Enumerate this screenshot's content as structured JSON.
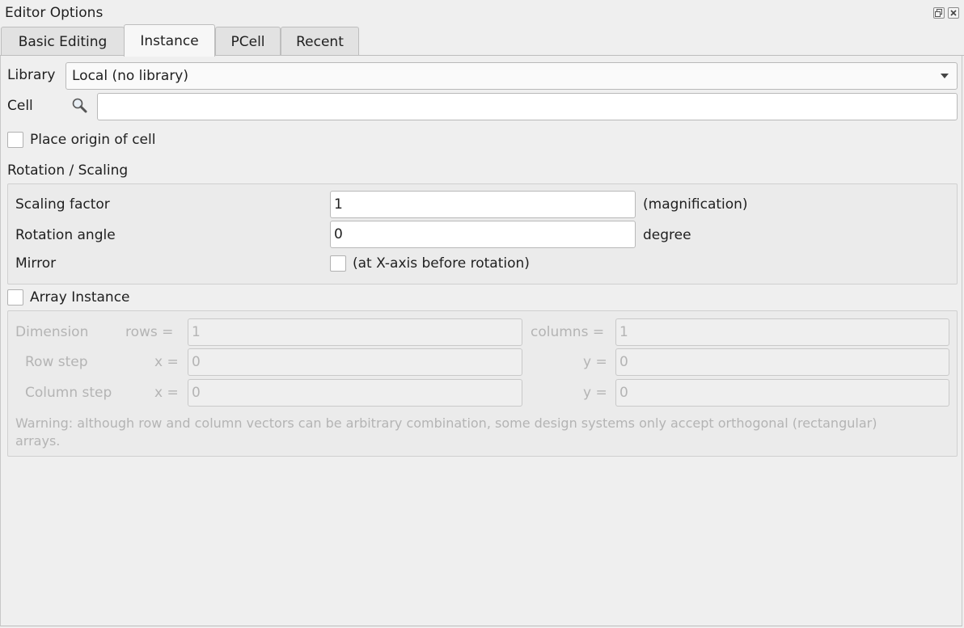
{
  "window": {
    "title": "Editor Options"
  },
  "tabs": [
    {
      "label": "Basic Editing"
    },
    {
      "label": "Instance"
    },
    {
      "label": "PCell"
    },
    {
      "label": "Recent"
    }
  ],
  "library": {
    "label": "Library",
    "selected": "Local (no library)"
  },
  "cell": {
    "label": "Cell",
    "value": ""
  },
  "place_origin": {
    "label": "Place origin of cell"
  },
  "rotation": {
    "title": "Rotation / Scaling",
    "scaling_label": "Scaling factor",
    "scaling_value": "1",
    "scaling_unit": "(magnification)",
    "angle_label": "Rotation angle",
    "angle_value": "0",
    "angle_unit": "degree",
    "mirror_label": "Mirror",
    "mirror_desc": "(at X-axis before rotation)"
  },
  "array": {
    "label": "Array Instance",
    "dimension_label": "Dimension",
    "rows_label": "rows =",
    "rows_value": "1",
    "columns_label": "columns =",
    "columns_value": "1",
    "row_step_label": "Row step",
    "row_x_label": "x =",
    "row_x_value": "0",
    "row_y_label": "y =",
    "row_y_value": "0",
    "col_step_label": "Column step",
    "col_x_label": "x =",
    "col_x_value": "0",
    "col_y_label": "y =",
    "col_y_value": "0",
    "warning": "Warning: although row and column vectors can be arbitrary combination, some design systems only accept orthogonal (rectangular) arrays."
  },
  "icons": {
    "float": "float-icon",
    "close": "close-icon",
    "search": "search-icon"
  }
}
